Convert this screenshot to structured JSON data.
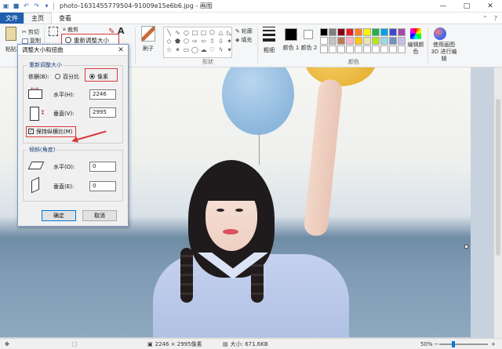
{
  "titlebar": {
    "title": "photo-1631455779504-91009e15e6b6.jpg - 画图",
    "minimize": "—",
    "maximize": "□",
    "close": "✕"
  },
  "menu": {
    "file": "文件",
    "home": "主页",
    "view": "查看"
  },
  "ribbon": {
    "paste": "粘贴",
    "cut": "剪切",
    "copy": "复制",
    "crop": "裁剪",
    "resize": "重新调整大小",
    "brushes": "刷子",
    "shapes_label": "形状",
    "outline": "轮廓",
    "fill": "填充",
    "size": "粗细",
    "color1": "颜色 1",
    "color2": "颜色 2",
    "colors_label": "颜色",
    "edit_colors": "编辑颜色",
    "paint3d": "使用画图 3D 进行编辑",
    "palette": [
      "#000000",
      "#7f7f7f",
      "#880015",
      "#ed1c24",
      "#ff7f27",
      "#fff200",
      "#22b14c",
      "#00a2e8",
      "#3f48cc",
      "#a349a4",
      "#ffffff",
      "#c3c3c3",
      "#b97a57",
      "#ffaec9",
      "#ffc90e",
      "#efe4b0",
      "#b5e61d",
      "#99d9ea",
      "#7092be",
      "#c8bfe7",
      "#ffffff",
      "#ffffff",
      "#ffffff",
      "#ffffff",
      "#ffffff",
      "#ffffff",
      "#ffffff",
      "#ffffff",
      "#ffffff",
      "#ffffff"
    ]
  },
  "dialog": {
    "title": "调整大小和扭曲",
    "close": "✕",
    "resize_legend": "重新调整大小",
    "by_label": "依据(B):",
    "percent": "百分比",
    "pixels": "像素",
    "horizontal_label": "水平(H):",
    "horizontal_value": "2246",
    "vertical_label": "垂直(V):",
    "vertical_value": "2995",
    "keep_ratio": "保持纵横比(M)",
    "skew_legend": "倾斜(角度)",
    "skew_h_label": "水平(O):",
    "skew_h_value": "0",
    "skew_v_label": "垂直(E):",
    "skew_v_value": "0",
    "ok": "确定",
    "cancel": "取消"
  },
  "statusbar": {
    "dimensions": "2246 × 2995像素",
    "size": "大小: 671.6KB",
    "zoom": "50%"
  }
}
